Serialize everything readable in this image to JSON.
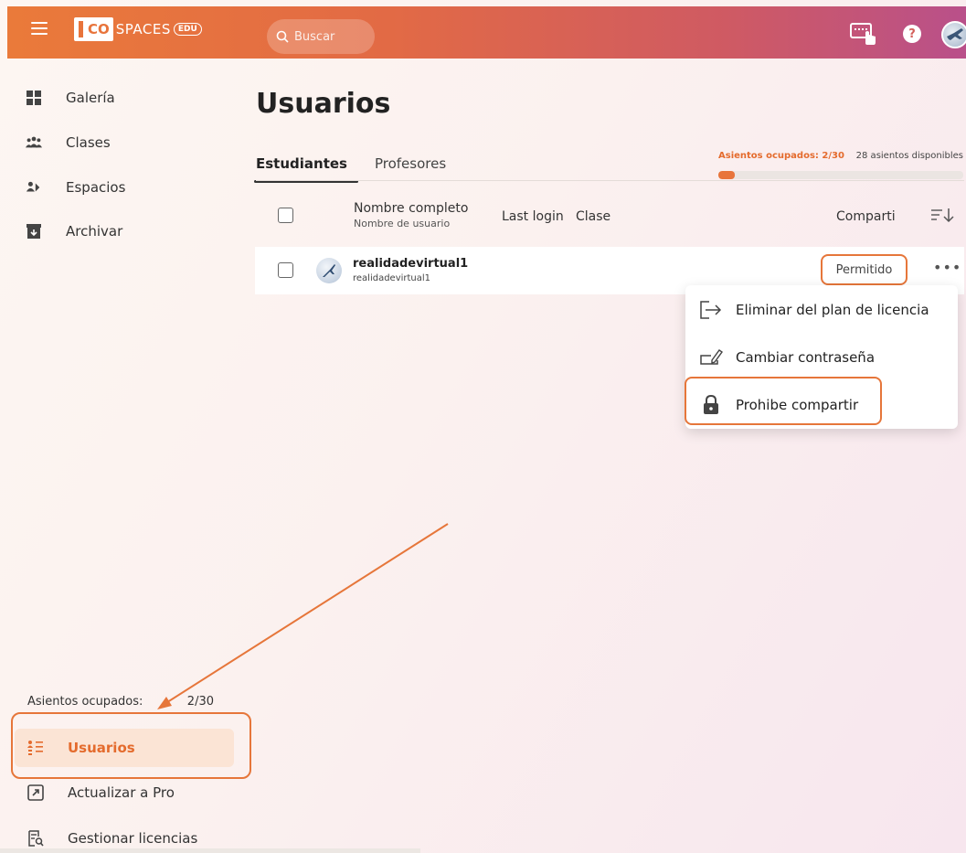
{
  "topbar": {
    "logo_co": "CO",
    "logo_spaces": "SPACES",
    "logo_edu": "EDU",
    "search_placeholder": "Buscar"
  },
  "sidebar": {
    "items": [
      {
        "label": "Galería",
        "icon": "gallery-icon"
      },
      {
        "label": "Clases",
        "icon": "classes-icon"
      },
      {
        "label": "Espacios",
        "icon": "spaces-icon"
      },
      {
        "label": "Archivar",
        "icon": "archive-icon"
      }
    ],
    "seats_label": "Asientos ocupados:",
    "seats_value": "2/30",
    "bottom_items": [
      {
        "label": "Usuarios",
        "icon": "users-list-icon",
        "active": true
      },
      {
        "label": "Actualizar a Pro",
        "icon": "external-arrow-icon"
      },
      {
        "label": "Gestionar licencias",
        "icon": "license-search-icon"
      }
    ]
  },
  "main": {
    "title": "Usuarios",
    "tabs": [
      {
        "label": "Estudiantes",
        "active": true
      },
      {
        "label": "Profesores",
        "active": false
      }
    ],
    "seats": {
      "used_label": "Asientos ocupados: 2/30",
      "available_label": "28 asientos disponibles",
      "used": 2,
      "total": 30
    },
    "table": {
      "headers": {
        "name": "Nombre completo",
        "username": "Nombre de usuario",
        "last_login": "Last login",
        "clase": "Clase",
        "share": "Compartir"
      },
      "rows": [
        {
          "name": "realidadevirtual1",
          "username": "realidadevirtual1",
          "share_status": "Permitido"
        }
      ]
    },
    "context_menu": [
      {
        "label": "Eliminar del plan de licencia",
        "icon": "remove-from-plan-icon"
      },
      {
        "label": "Cambiar contraseña",
        "icon": "change-password-icon"
      },
      {
        "label": "Prohibe compartir",
        "icon": "lock-icon"
      }
    ]
  },
  "colors": {
    "accent": "#e8743b",
    "topbar_start": "#ea7a3a",
    "topbar_end": "#b9508a",
    "active_bg": "#fbe4d5"
  }
}
